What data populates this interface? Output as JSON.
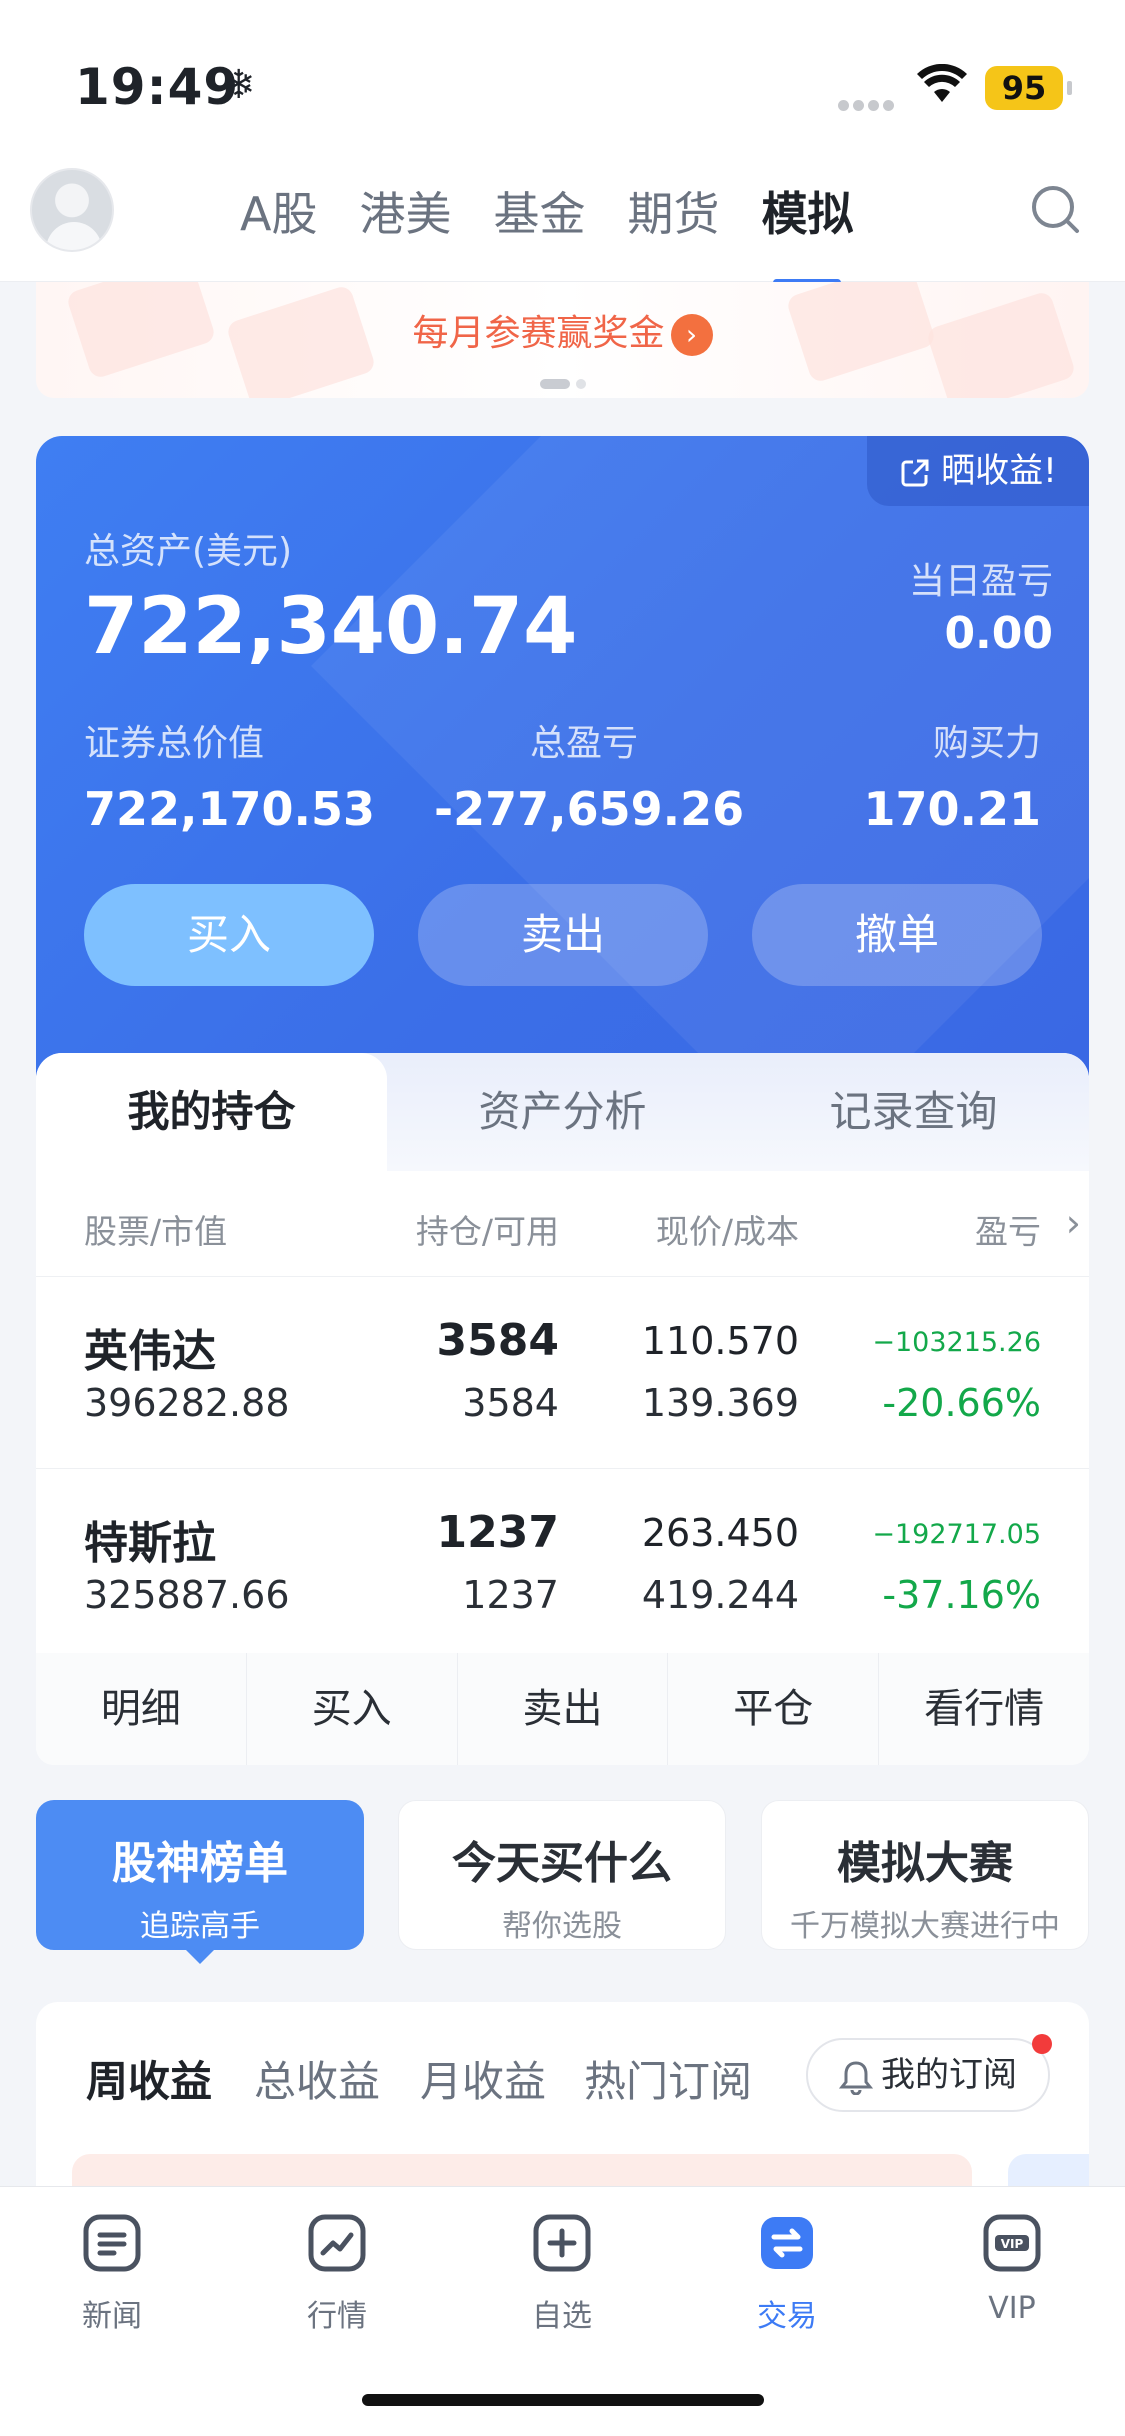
{
  "status_bar": {
    "time": "19:49",
    "battery": "95"
  },
  "header": {
    "tabs": [
      {
        "label": "A股",
        "active": false
      },
      {
        "label": "港美",
        "active": false
      },
      {
        "label": "基金",
        "active": false
      },
      {
        "label": "期货",
        "active": false
      },
      {
        "label": "模拟",
        "active": true
      }
    ]
  },
  "banner": {
    "text": "每月参赛赢奖金",
    "arrow": "›"
  },
  "account": {
    "share_label": "晒收益!",
    "total_assets_label": "总资产(美元)",
    "total_assets": "722,340.74",
    "daily_pnl_label": "当日盈亏",
    "daily_pnl": "0.00",
    "securities_value_label": "证券总价值",
    "securities_value": "722,170.53",
    "total_pnl_label": "总盈亏",
    "total_pnl": "-277,659.26",
    "buying_power_label": "购买力",
    "buying_power": "170.21",
    "buy_label": "买入",
    "sell_label": "卖出",
    "cancel_label": "撤单"
  },
  "holdings": {
    "tabs": [
      "我的持仓",
      "资产分析",
      "记录查询"
    ],
    "headers": [
      "股票/市值",
      "持仓/可用",
      "现价/成本",
      "盈亏"
    ],
    "rows": [
      {
        "name": "英伟达",
        "market_value": "396282.88",
        "position": "3584",
        "available": "3584",
        "price": "110.570",
        "cost": "139.369",
        "pnl": "−103215.26",
        "pnl_pct": "-20.66%"
      },
      {
        "name": "特斯拉",
        "market_value": "325887.66",
        "position": "1237",
        "available": "1237",
        "price": "263.450",
        "cost": "419.244",
        "pnl": "−192717.05",
        "pnl_pct": "-37.16%"
      }
    ],
    "actions": [
      "明细",
      "买入",
      "卖出",
      "平仓",
      "看行情"
    ]
  },
  "features": [
    {
      "title": "股神榜单",
      "subtitle": "追踪高手"
    },
    {
      "title": "今天买什么",
      "subtitle": "帮你选股"
    },
    {
      "title": "模拟大赛",
      "subtitle": "千万模拟大赛进行中"
    }
  ],
  "ranking": {
    "tabs": [
      "周收益",
      "总收益",
      "月收益",
      "热门订阅"
    ],
    "subscribe_label": "我的订阅"
  },
  "bottom_nav": [
    {
      "label": "新闻",
      "icon": "news-icon"
    },
    {
      "label": "行情",
      "icon": "market-icon"
    },
    {
      "label": "自选",
      "icon": "watchlist-icon"
    },
    {
      "label": "交易",
      "icon": "trade-icon",
      "active": true
    },
    {
      "label": "VIP",
      "icon": "vip-icon"
    }
  ],
  "colors": {
    "accent": "#3d7bf5",
    "card_blue": "#3b6fe8",
    "loss_green": "#13a84a",
    "alert_red": "#f23b3b"
  }
}
